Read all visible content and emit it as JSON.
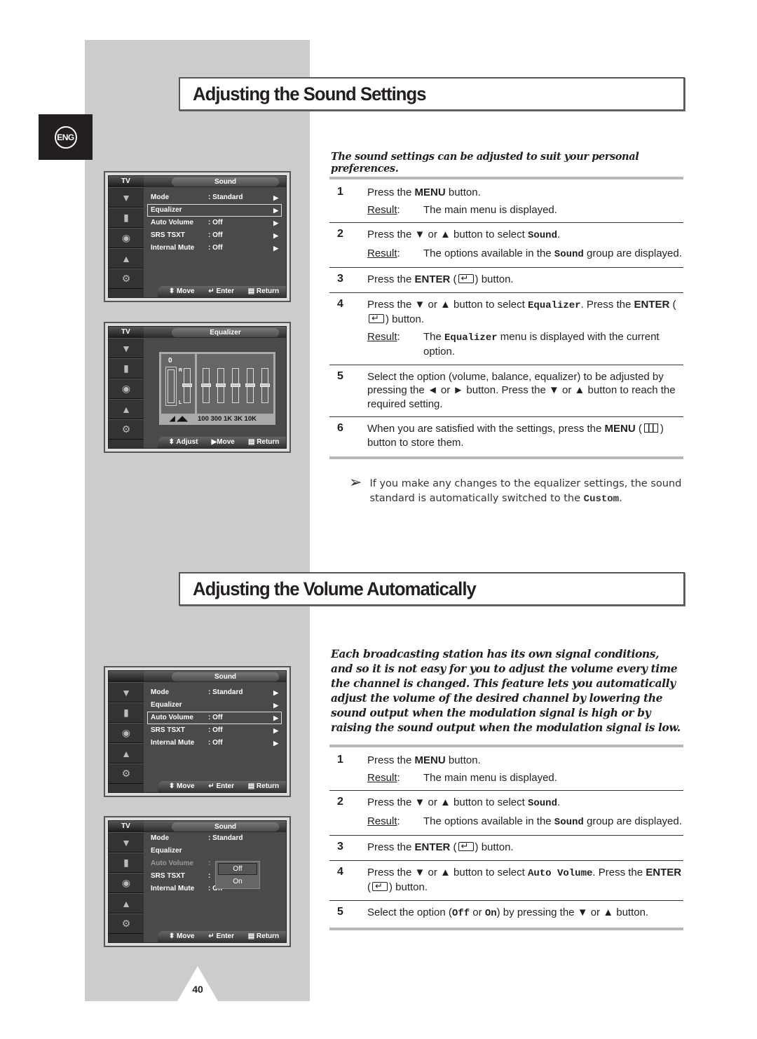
{
  "language_tab": "ENG",
  "page_number": "40",
  "section1": {
    "title": "Adjusting the Sound Settings",
    "intro": "The sound settings can be adjusted to suit your personal preferences.",
    "steps": [
      {
        "num": "1",
        "pre": "Press the ",
        "key": "MENU",
        "post": " button.",
        "result_label": "Result",
        "result": "The main menu is displayed."
      },
      {
        "num": "2",
        "pre": "Press the ▼ or ▲ button to select ",
        "code": "Sound",
        "post": ".",
        "result_label": "Result",
        "result_pre": "The options available in the ",
        "result_code": "Sound",
        "result_post": " group are displayed."
      },
      {
        "num": "3",
        "pre": "Press the ",
        "key": "ENTER",
        "post": " button."
      },
      {
        "num": "4",
        "pre": "Press the ▼ or ▲ button to select ",
        "code": "Equalizer",
        "mid": ". Press the ",
        "key": "ENTER",
        "post": " button.",
        "result_label": "Result",
        "result_pre": "The ",
        "result_code": "Equalizer",
        "result_post": " menu is displayed with the current option."
      },
      {
        "num": "5",
        "text": "Select the option (volume, balance, equalizer) to be adjusted by pressing the ◄ or ► button. Press the ▼ or ▲ button to reach the required setting."
      },
      {
        "num": "6",
        "pre": "When you are satisfied with the settings, press the ",
        "key": "MENU",
        "post": " button to store them."
      }
    ],
    "note": {
      "text": "If you make any changes to the equalizer settings, the sound standard is automatically switched to the ",
      "code": "Custom",
      "end": "."
    }
  },
  "section2": {
    "title": "Adjusting the Volume Automatically",
    "intro": "Each broadcasting station has its own signal conditions, and so it is not easy for you to adjust the volume every time the channel is changed. This feature lets you automatically adjust the volume of the desired channel by lowering the sound output when the modulation signal is high or by raising the sound output when the modulation signal is low.",
    "steps": [
      {
        "num": "1",
        "pre": "Press the ",
        "key": "MENU",
        "post": " button.",
        "result_label": "Result",
        "result": "The main menu is displayed."
      },
      {
        "num": "2",
        "pre": "Press the ▼ or ▲ button to select ",
        "code": "Sound",
        "post": ".",
        "result_label": "Result",
        "result_pre": "The options available in the ",
        "result_code": "Sound",
        "result_post": " group are displayed."
      },
      {
        "num": "3",
        "pre": "Press the ",
        "key": "ENTER",
        "post": " button."
      },
      {
        "num": "4",
        "pre": "Press the ▼ or ▲ button to select ",
        "code": "Auto Volume",
        "mid": ". Press the ",
        "key": "ENTER",
        "post": " button."
      },
      {
        "num": "5",
        "pre": "Select the option (",
        "code1": "Off",
        "or": " or ",
        "code2": "On",
        "post": ") by pressing the ▼ or ▲ button."
      }
    ]
  },
  "osd": {
    "tv_label": "TV",
    "sound_title": "Sound",
    "equalizer_title": "Equalizer",
    "rows": [
      {
        "label": "Mode",
        "value": ": Standard"
      },
      {
        "label": "Equalizer",
        "value": ""
      },
      {
        "label": "Auto Volume",
        "value": ": Off"
      },
      {
        "label": "SRS TSXT",
        "value": ": Off"
      },
      {
        "label": "Internal Mute",
        "value": ": Off"
      }
    ],
    "footer": {
      "move": "Move",
      "enter": "Enter",
      "return": "Return",
      "adjust": "Adjust"
    },
    "popup": {
      "options": [
        "Off",
        "On"
      ],
      "selected": "Off"
    },
    "eq": {
      "volume_value": "0",
      "balance_r": "R",
      "balance_l": "L",
      "freq_labels": "100 300 1K 3K 10K",
      "bands": [
        "100",
        "300",
        "1K",
        "3K",
        "10K"
      ],
      "band_levels": [
        0,
        0,
        0,
        0,
        0
      ],
      "balance_level": 0,
      "volume_level": 0
    },
    "side_icons": [
      "input-icon",
      "picture-icon",
      "sound-icon",
      "channel-icon",
      "setup-icon"
    ]
  }
}
